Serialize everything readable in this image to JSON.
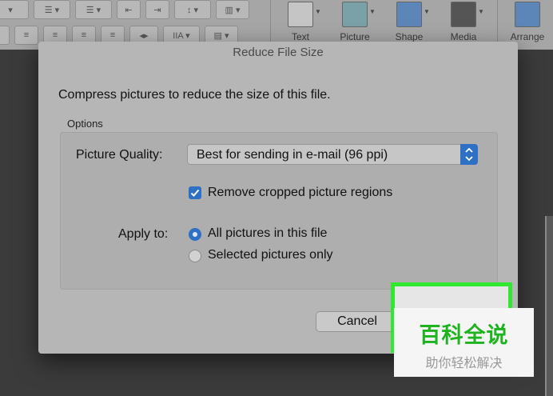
{
  "toolbar": {
    "items": [
      {
        "label": "Text",
        "icon": "text-box-icon"
      },
      {
        "label": "Picture",
        "icon": "picture-icon"
      },
      {
        "label": "Shape",
        "icon": "shape-icon"
      },
      {
        "label": "Media",
        "icon": "media-icon"
      },
      {
        "label": "Arrange",
        "icon": "arrange-icon"
      }
    ]
  },
  "dialog": {
    "title": "Reduce File Size",
    "message": "Compress pictures to reduce the size of this file.",
    "options_legend": "Options",
    "picture_quality_label": "Picture Quality:",
    "picture_quality_value": "Best for sending in e-mail (96 ppi)",
    "remove_cropped_label": "Remove cropped picture regions",
    "remove_cropped_checked": true,
    "apply_to_label": "Apply to:",
    "apply_options": [
      {
        "label": "All pictures in this file",
        "selected": true
      },
      {
        "label": "Selected pictures only",
        "selected": false
      }
    ],
    "cancel_label": "Cancel"
  },
  "watermark": {
    "main": "百科全说",
    "sub": "助你轻松解决"
  },
  "colors": {
    "accent": "#2e70c4",
    "highlight": "#2fe82f",
    "watermark_text": "#1fb31f"
  }
}
